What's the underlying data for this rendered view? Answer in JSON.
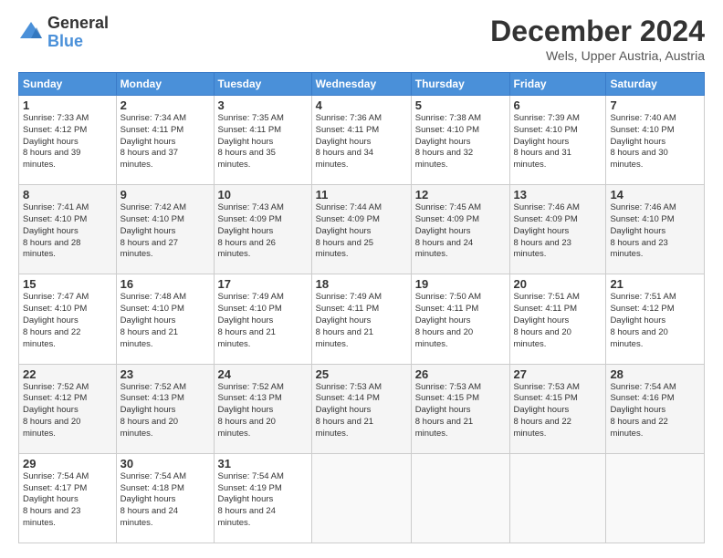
{
  "header": {
    "logo_general": "General",
    "logo_blue": "Blue",
    "month_title": "December 2024",
    "location": "Wels, Upper Austria, Austria"
  },
  "weekdays": [
    "Sunday",
    "Monday",
    "Tuesday",
    "Wednesday",
    "Thursday",
    "Friday",
    "Saturday"
  ],
  "rows": [
    [
      {
        "day": "1",
        "sunrise": "7:33 AM",
        "sunset": "4:12 PM",
        "daylight": "8 hours and 39 minutes."
      },
      {
        "day": "2",
        "sunrise": "7:34 AM",
        "sunset": "4:11 PM",
        "daylight": "8 hours and 37 minutes."
      },
      {
        "day": "3",
        "sunrise": "7:35 AM",
        "sunset": "4:11 PM",
        "daylight": "8 hours and 35 minutes."
      },
      {
        "day": "4",
        "sunrise": "7:36 AM",
        "sunset": "4:11 PM",
        "daylight": "8 hours and 34 minutes."
      },
      {
        "day": "5",
        "sunrise": "7:38 AM",
        "sunset": "4:10 PM",
        "daylight": "8 hours and 32 minutes."
      },
      {
        "day": "6",
        "sunrise": "7:39 AM",
        "sunset": "4:10 PM",
        "daylight": "8 hours and 31 minutes."
      },
      {
        "day": "7",
        "sunrise": "7:40 AM",
        "sunset": "4:10 PM",
        "daylight": "8 hours and 30 minutes."
      }
    ],
    [
      {
        "day": "8",
        "sunrise": "7:41 AM",
        "sunset": "4:10 PM",
        "daylight": "8 hours and 28 minutes."
      },
      {
        "day": "9",
        "sunrise": "7:42 AM",
        "sunset": "4:10 PM",
        "daylight": "8 hours and 27 minutes."
      },
      {
        "day": "10",
        "sunrise": "7:43 AM",
        "sunset": "4:09 PM",
        "daylight": "8 hours and 26 minutes."
      },
      {
        "day": "11",
        "sunrise": "7:44 AM",
        "sunset": "4:09 PM",
        "daylight": "8 hours and 25 minutes."
      },
      {
        "day": "12",
        "sunrise": "7:45 AM",
        "sunset": "4:09 PM",
        "daylight": "8 hours and 24 minutes."
      },
      {
        "day": "13",
        "sunrise": "7:46 AM",
        "sunset": "4:09 PM",
        "daylight": "8 hours and 23 minutes."
      },
      {
        "day": "14",
        "sunrise": "7:46 AM",
        "sunset": "4:10 PM",
        "daylight": "8 hours and 23 minutes."
      }
    ],
    [
      {
        "day": "15",
        "sunrise": "7:47 AM",
        "sunset": "4:10 PM",
        "daylight": "8 hours and 22 minutes."
      },
      {
        "day": "16",
        "sunrise": "7:48 AM",
        "sunset": "4:10 PM",
        "daylight": "8 hours and 21 minutes."
      },
      {
        "day": "17",
        "sunrise": "7:49 AM",
        "sunset": "4:10 PM",
        "daylight": "8 hours and 21 minutes."
      },
      {
        "day": "18",
        "sunrise": "7:49 AM",
        "sunset": "4:11 PM",
        "daylight": "8 hours and 21 minutes."
      },
      {
        "day": "19",
        "sunrise": "7:50 AM",
        "sunset": "4:11 PM",
        "daylight": "8 hours and 20 minutes."
      },
      {
        "day": "20",
        "sunrise": "7:51 AM",
        "sunset": "4:11 PM",
        "daylight": "8 hours and 20 minutes."
      },
      {
        "day": "21",
        "sunrise": "7:51 AM",
        "sunset": "4:12 PM",
        "daylight": "8 hours and 20 minutes."
      }
    ],
    [
      {
        "day": "22",
        "sunrise": "7:52 AM",
        "sunset": "4:12 PM",
        "daylight": "8 hours and 20 minutes."
      },
      {
        "day": "23",
        "sunrise": "7:52 AM",
        "sunset": "4:13 PM",
        "daylight": "8 hours and 20 minutes."
      },
      {
        "day": "24",
        "sunrise": "7:52 AM",
        "sunset": "4:13 PM",
        "daylight": "8 hours and 20 minutes."
      },
      {
        "day": "25",
        "sunrise": "7:53 AM",
        "sunset": "4:14 PM",
        "daylight": "8 hours and 21 minutes."
      },
      {
        "day": "26",
        "sunrise": "7:53 AM",
        "sunset": "4:15 PM",
        "daylight": "8 hours and 21 minutes."
      },
      {
        "day": "27",
        "sunrise": "7:53 AM",
        "sunset": "4:15 PM",
        "daylight": "8 hours and 22 minutes."
      },
      {
        "day": "28",
        "sunrise": "7:54 AM",
        "sunset": "4:16 PM",
        "daylight": "8 hours and 22 minutes."
      }
    ],
    [
      {
        "day": "29",
        "sunrise": "7:54 AM",
        "sunset": "4:17 PM",
        "daylight": "8 hours and 23 minutes."
      },
      {
        "day": "30",
        "sunrise": "7:54 AM",
        "sunset": "4:18 PM",
        "daylight": "8 hours and 24 minutes."
      },
      {
        "day": "31",
        "sunrise": "7:54 AM",
        "sunset": "4:19 PM",
        "daylight": "8 hours and 24 minutes."
      },
      null,
      null,
      null,
      null
    ]
  ]
}
